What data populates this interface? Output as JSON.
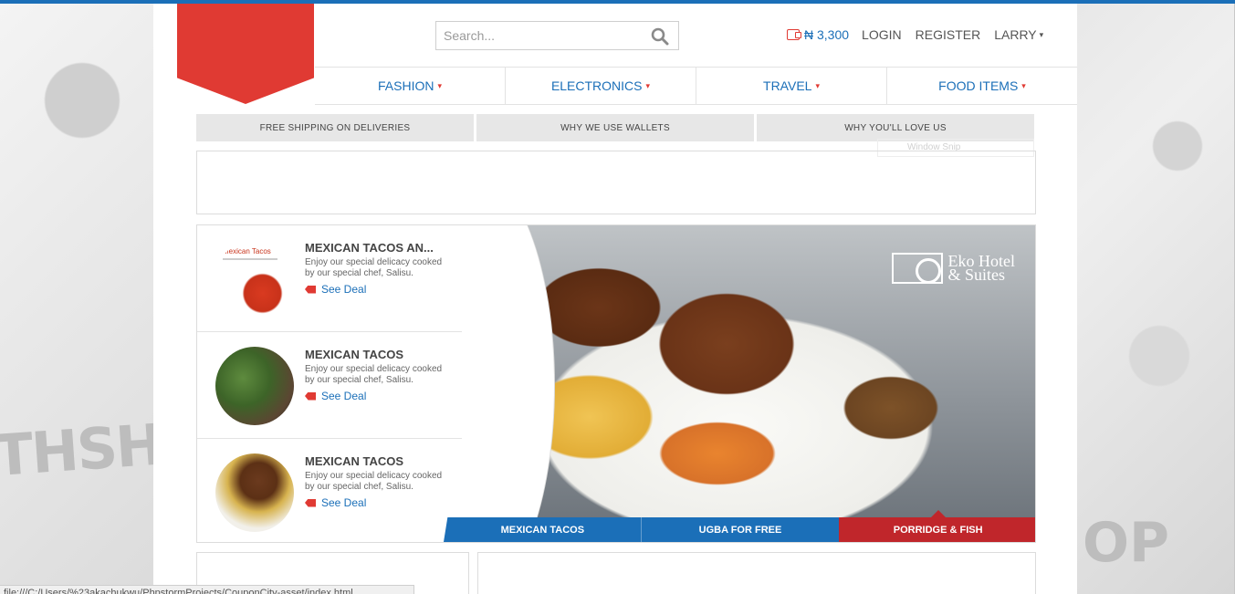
{
  "search": {
    "placeholder": "Search..."
  },
  "user_nav": {
    "wallet_amount": "₦ 3,300",
    "login": "LOGIN",
    "register": "REGISTER",
    "username": "LARRY"
  },
  "main_nav": [
    "FASHION",
    "ELECTRONICS",
    "TRAVEL",
    "FOOD ITEMS"
  ],
  "info_bar": [
    "FREE SHIPPING ON DELIVERIES",
    "WHY WE USE WALLETS",
    "WHY YOU'LL LOVE US"
  ],
  "deals": [
    {
      "title": "MEXICAN TACOS AN...",
      "description": "Enjoy our special delicacy cooked by our special chef, Salisu.",
      "link": "See Deal",
      "thumb_title": "Mexican Tacos"
    },
    {
      "title": "MEXICAN TACOS",
      "description": "Enjoy our special delicacy cooked by our special chef, Salisu.",
      "link": "See Deal"
    },
    {
      "title": "MEXICAN TACOS",
      "description": "Enjoy our special delicacy cooked by our special chef, Salisu.",
      "link": "See Deal"
    }
  ],
  "hero": {
    "logo_line1": "Eko Hotel",
    "logo_line2": "& Suites"
  },
  "hero_tabs": [
    "MEXICAN TACOS",
    "UGBA FOR FREE",
    "PORRIDGE & FISH"
  ],
  "overlay": {
    "snip_label": "Window Snip"
  },
  "status_bar": "file:///C:/Users/%23akachukwu/PhpstormProjects/CouponCity-asset/index.html",
  "colors": {
    "accent_blue": "#1b6fb8",
    "accent_red": "#e03a33",
    "active_tab": "#c0262b"
  }
}
